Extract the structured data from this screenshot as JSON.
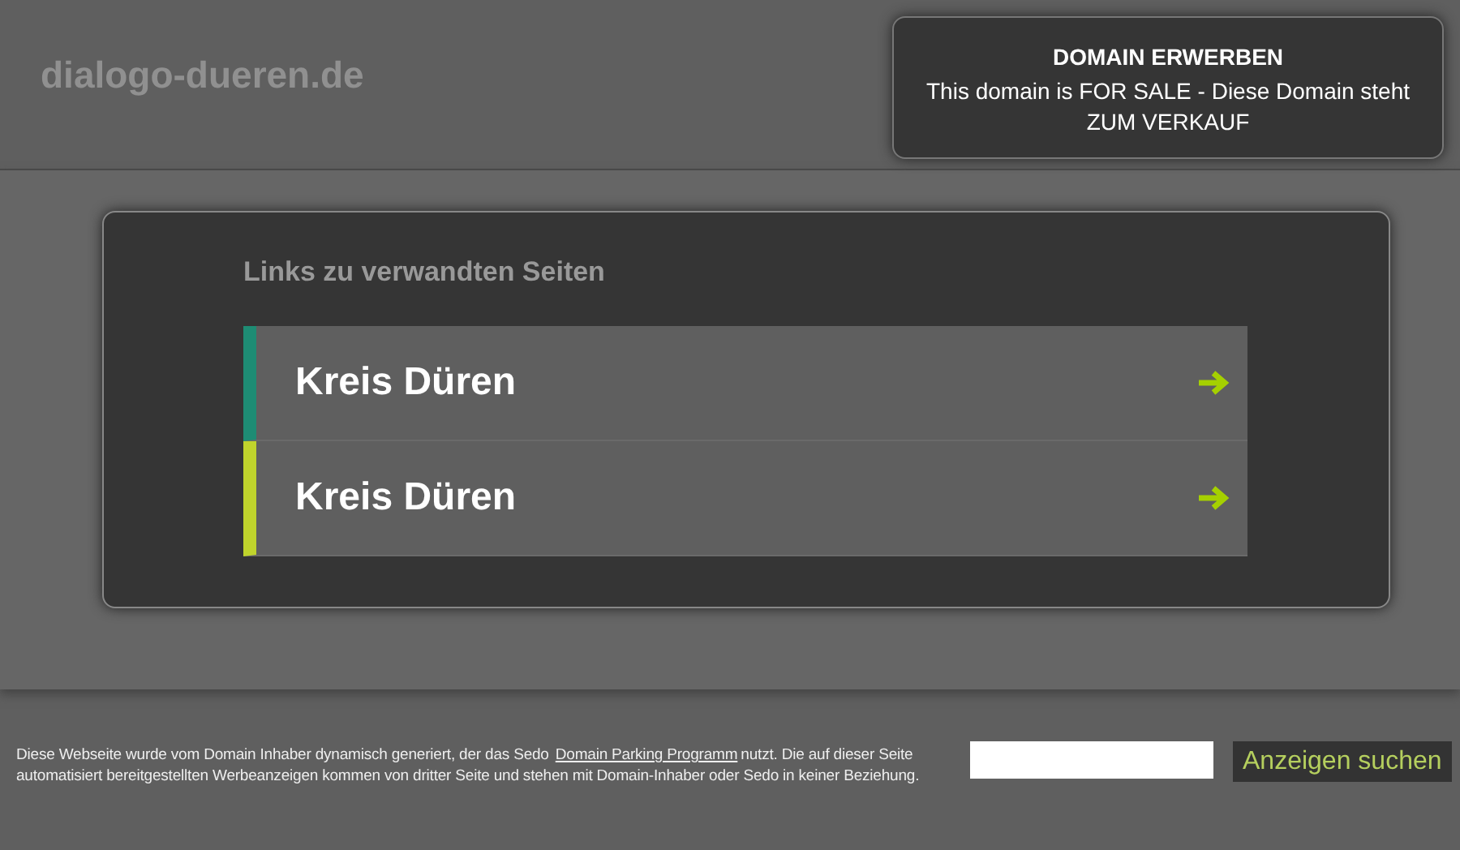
{
  "header": {
    "site_name": "dialogo-dueren.de",
    "sale_box": {
      "title": "DOMAIN ERWERBEN",
      "text": "This domain is FOR SALE - Diese Domain steht ZUM VERKAUF"
    }
  },
  "related": {
    "heading": "Links zu verwandten Seiten",
    "links": [
      {
        "label": "Kreis Düren",
        "color": "#1e8c74"
      },
      {
        "label": "Kreis Düren",
        "color": "#c0d42c"
      }
    ]
  },
  "footer": {
    "text_before": "Diese Webseite wurde vom Domain Inhaber dynamisch generiert, der das Sedo",
    "link": "Domain Parking Programm",
    "text_after": "nutzt. Die auf dieser Seite automatisiert bereitgestellten Werbeanzeigen kommen von dritter Seite und stehen mit Domain-Inhaber oder Sedo in keiner Beziehung.",
    "search_button": "Anzeigen suchen"
  }
}
